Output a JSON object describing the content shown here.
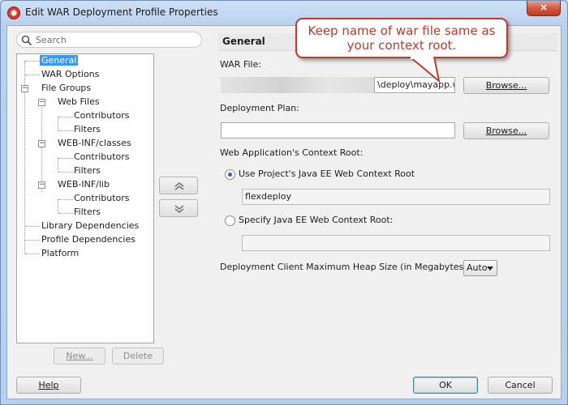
{
  "window": {
    "title": "Edit WAR Deployment Profile Properties",
    "close_glyph": "×"
  },
  "search": {
    "placeholder": "Search"
  },
  "tree": [
    {
      "label": "General",
      "selected": true
    },
    {
      "label": "WAR Options"
    },
    {
      "label": "File Groups"
    },
    {
      "label": "Web Files"
    },
    {
      "label": "Contributors"
    },
    {
      "label": "Filters"
    },
    {
      "label": "WEB-INF/classes"
    },
    {
      "label": "Contributors"
    },
    {
      "label": "Filters"
    },
    {
      "label": "WEB-INF/lib"
    },
    {
      "label": "Contributors"
    },
    {
      "label": "Filters"
    },
    {
      "label": "Library Dependencies"
    },
    {
      "label": "Profile Dependencies"
    },
    {
      "label": "Platform"
    }
  ],
  "tree_buttons": {
    "new": "New...",
    "delete": "Delete"
  },
  "panel": {
    "title": "General",
    "war_file_label": "WAR File:",
    "war_file_value": "\\deploy\\mayapp.war",
    "browse": "Browse...",
    "deployment_plan_label": "Deployment Plan:",
    "deployment_plan_value": "",
    "context_root_label": "Web Application's Context Root:",
    "use_project_label": "Use Project's Java EE Web Context Root",
    "use_project_value": "flexdeploy",
    "specify_label": "Specify Java EE Web Context Root:",
    "specify_value": "",
    "heap_label": "Deployment Client Maximum Heap Size (in Megabytes):",
    "heap_value": "Auto"
  },
  "callout": {
    "line1": "Keep name of war file same as",
    "line2": "your context root.",
    "color": "#c0392b"
  },
  "footer": {
    "help": "Help",
    "ok": "OK",
    "cancel": "Cancel"
  }
}
